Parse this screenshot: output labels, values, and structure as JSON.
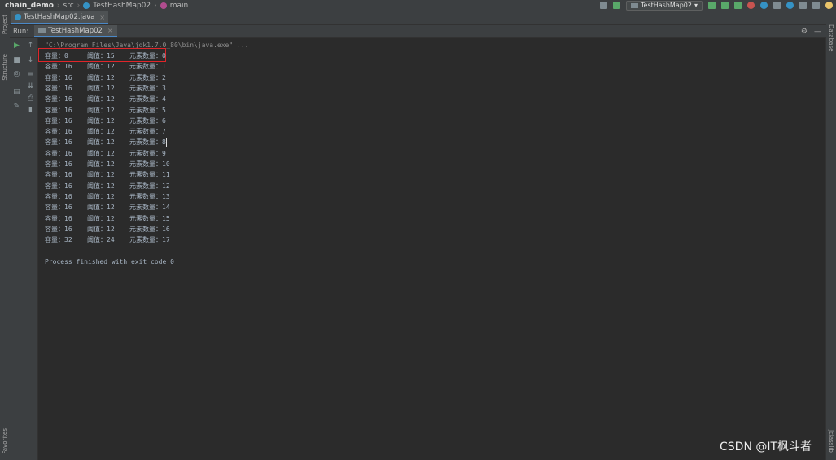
{
  "breadcrumb": {
    "project": "chain_demo",
    "folder": "src",
    "class": "TestHashMap02",
    "method": "main"
  },
  "toolbar": {
    "run_config": "TestHashMap02"
  },
  "editor_tab": {
    "label": "TestHashMap02.java",
    "close": "×"
  },
  "left_tools": {
    "project": "Project",
    "structure": "Structure",
    "favorites": "Favorites"
  },
  "right_tools": {
    "database": "Database",
    "maven": "Jclasslib"
  },
  "run": {
    "label": "Run:",
    "tab_label": "TestHashMap02"
  },
  "console": {
    "command": "\"C:\\Program Files\\Java\\jdk1.7.0_80\\bin\\java.exe\" ...",
    "rows": [
      {
        "cap": "容量：0",
        "thr": "阈值：15",
        "cnt": "元素数量：0"
      },
      {
        "cap": "容量：16",
        "thr": "阈值：12",
        "cnt": "元素数量：1"
      },
      {
        "cap": "容量：16",
        "thr": "阈值：12",
        "cnt": "元素数量：2"
      },
      {
        "cap": "容量：16",
        "thr": "阈值：12",
        "cnt": "元素数量：3"
      },
      {
        "cap": "容量：16",
        "thr": "阈值：12",
        "cnt": "元素数量：4"
      },
      {
        "cap": "容量：16",
        "thr": "阈值：12",
        "cnt": "元素数量：5"
      },
      {
        "cap": "容量：16",
        "thr": "阈值：12",
        "cnt": "元素数量：6"
      },
      {
        "cap": "容量：16",
        "thr": "阈值：12",
        "cnt": "元素数量：7"
      },
      {
        "cap": "容量：16",
        "thr": "阈值：12",
        "cnt": "元素数量：8"
      },
      {
        "cap": "容量：16",
        "thr": "阈值：12",
        "cnt": "元素数量：9"
      },
      {
        "cap": "容量：16",
        "thr": "阈值：12",
        "cnt": "元素数量：10"
      },
      {
        "cap": "容量：16",
        "thr": "阈值：12",
        "cnt": "元素数量：11"
      },
      {
        "cap": "容量：16",
        "thr": "阈值：12",
        "cnt": "元素数量：12"
      },
      {
        "cap": "容量：16",
        "thr": "阈值：12",
        "cnt": "元素数量：13"
      },
      {
        "cap": "容量：16",
        "thr": "阈值：12",
        "cnt": "元素数量：14"
      },
      {
        "cap": "容量：16",
        "thr": "阈值：12",
        "cnt": "元素数量：15"
      },
      {
        "cap": "容量：16",
        "thr": "阈值：12",
        "cnt": "元素数量：16"
      },
      {
        "cap": "容量：32",
        "thr": "阈值：24",
        "cnt": "元素数量：17"
      }
    ],
    "exit_message": "Process finished with exit code 0"
  },
  "watermark": "CSDN @IT枫斗者",
  "colors": {
    "highlight_box": "#e0252a",
    "console_bg": "#2b2b2b",
    "accent": "#4a88c7"
  }
}
